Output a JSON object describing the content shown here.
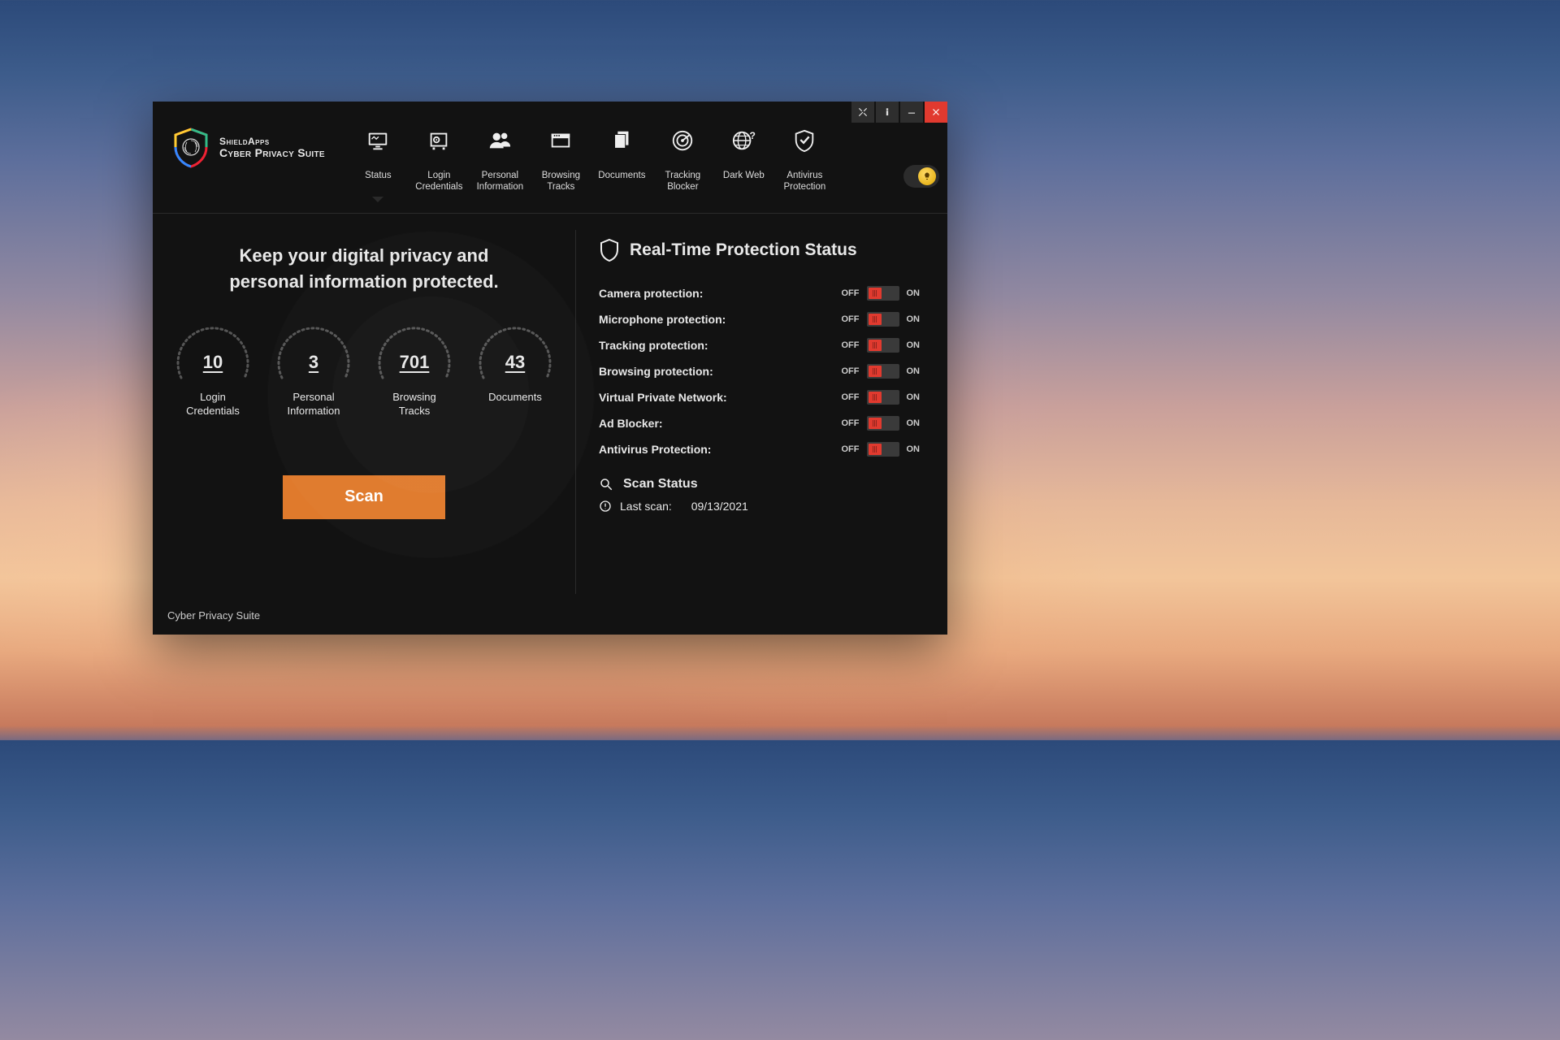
{
  "brand": {
    "top": "ShieldApps",
    "bottom": "Cyber Privacy Suite"
  },
  "nav": {
    "status": "Status",
    "login": "Login Credentials",
    "personal": "Personal Information",
    "browsing": "Browsing Tracks",
    "documents": "Documents",
    "tracking": "Tracking Blocker",
    "darkweb": "Dark Web",
    "antivirus": "Antivirus Protection"
  },
  "headline": {
    "l1": "Keep your digital privacy and",
    "l2": "personal information protected."
  },
  "gauges": {
    "login": {
      "value": "10",
      "label1": "Login",
      "label2": "Credentials"
    },
    "personal": {
      "value": "3",
      "label1": "Personal",
      "label2": "Information"
    },
    "browsing": {
      "value": "701",
      "label1": "Browsing",
      "label2": "Tracks"
    },
    "documents": {
      "value": "43",
      "label1": "Documents",
      "label2": ""
    }
  },
  "scan_button": "Scan",
  "breadcrumb": "Cyber Privacy Suite",
  "protection": {
    "title": "Real-Time Protection Status",
    "off": "OFF",
    "on": "ON",
    "items": {
      "camera": "Camera protection:",
      "microphone": "Microphone protection:",
      "tracking": "Tracking protection:",
      "browsing": "Browsing protection:",
      "vpn": "Virtual Private Network:",
      "adblocker": "Ad Blocker:",
      "antivirus": "Antivirus Protection:"
    }
  },
  "scan_status": {
    "title": "Scan Status",
    "last_label": "Last scan:",
    "last_value": "09/13/2021"
  }
}
